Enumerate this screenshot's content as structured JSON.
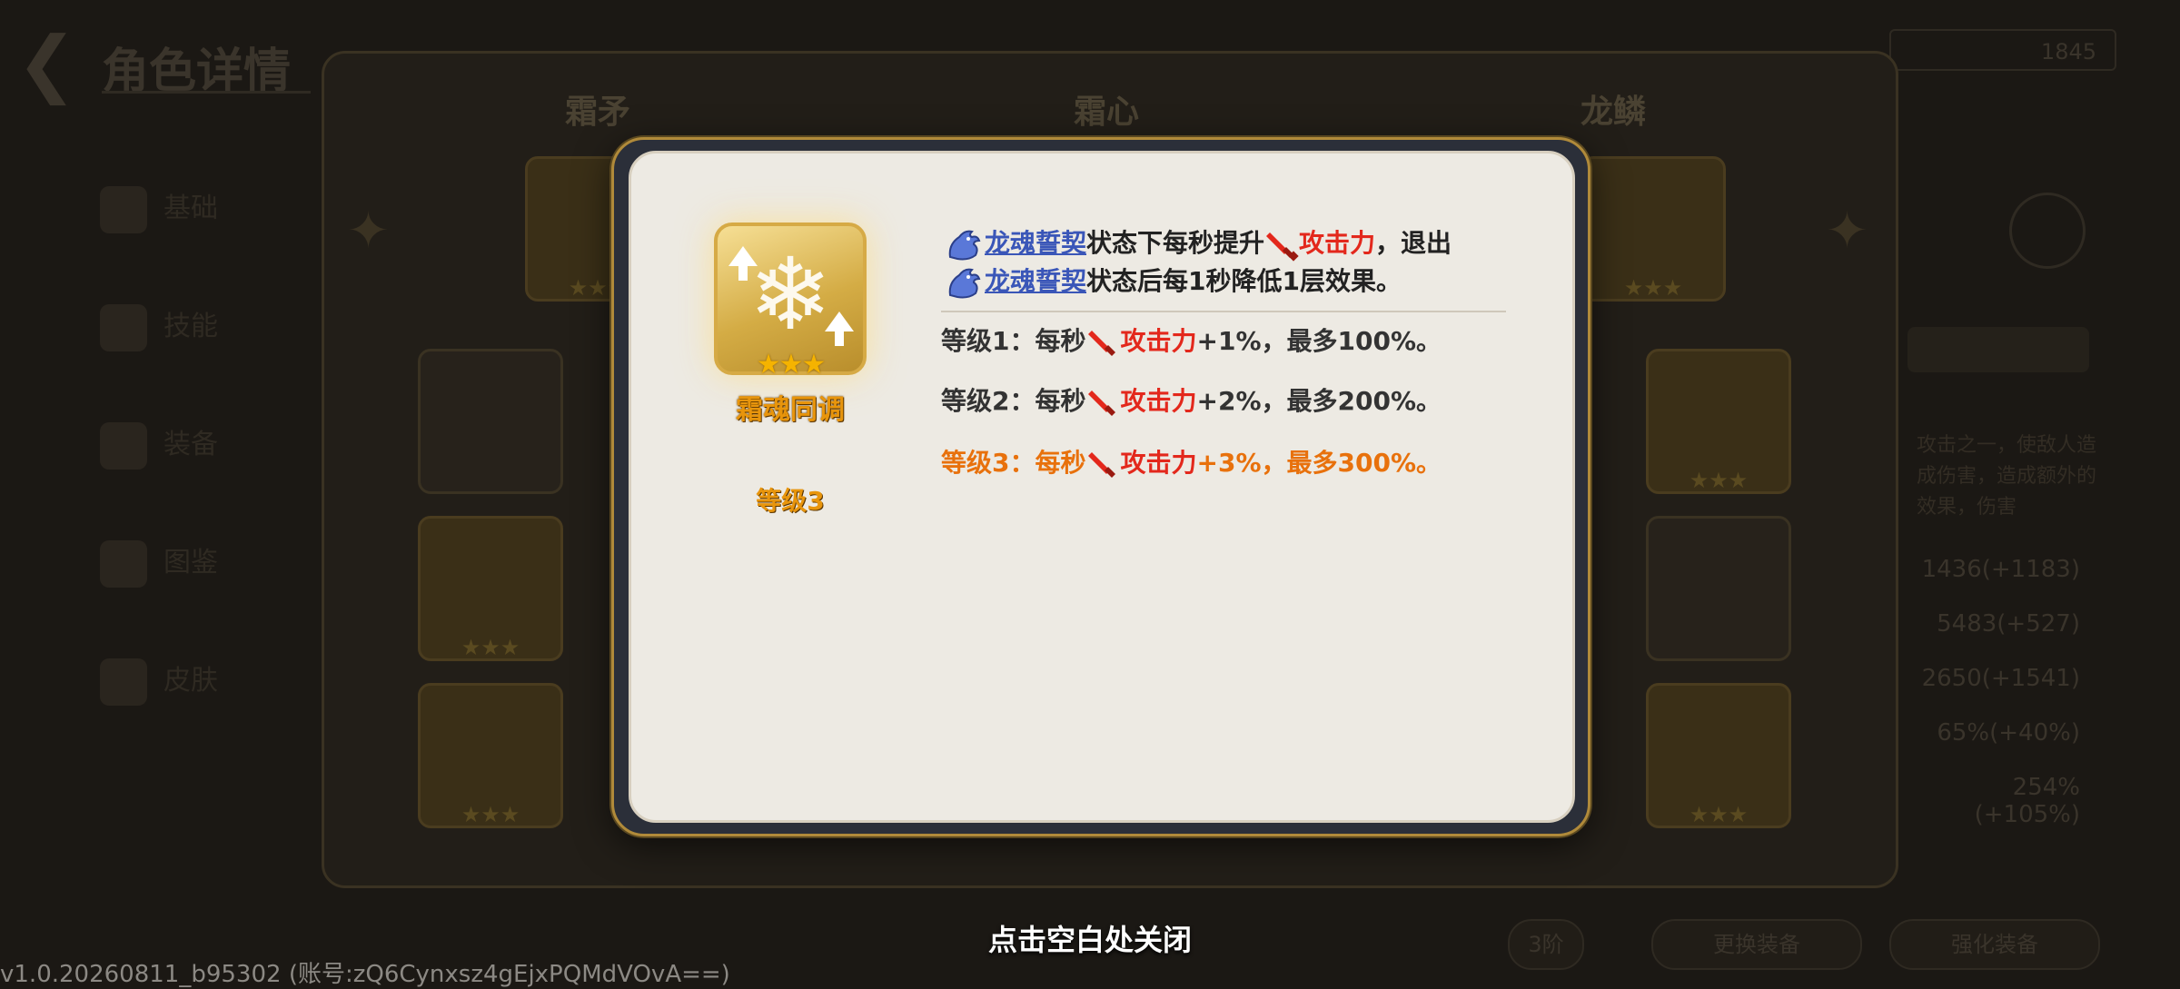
{
  "background": {
    "header_title": "角色详情",
    "top_right_value": "1845",
    "slot_labels": [
      "霜矛",
      "霜心",
      "龙鳞"
    ],
    "sidebar_items": [
      "基础",
      "技能",
      "装备",
      "图鉴",
      "皮肤"
    ],
    "stats": [
      "1436(+1183)",
      "5483(+527)",
      "2650(+1541)",
      "65%(+40%)",
      "254%(+105%)"
    ],
    "desc_text": "攻击之一，使敌人造成伤害，造成额外的效果，伤害",
    "bottom_buttons": [
      "3阶",
      "更换装备",
      "强化装备"
    ]
  },
  "skill": {
    "name": "霜魂同调",
    "stars": "★★★",
    "level": "等级3",
    "icon": "snowflake-upgrade-icon"
  },
  "description": {
    "line1": {
      "keyword": "龙魂誓契",
      "text_before_sword": "状态下每秒提升",
      "stat": "攻击力",
      "text_after": "，退出"
    },
    "line2": {
      "keyword": "龙魂誓契",
      "text": "状态后每1秒降低1层效果。"
    }
  },
  "levels": [
    {
      "label": "等级1：",
      "prefix": "每秒",
      "stat": "攻击力",
      "suffix": "+1%，最多100%。",
      "active": false
    },
    {
      "label": "等级2：",
      "prefix": "每秒",
      "stat": "攻击力",
      "suffix": "+2%，最多200%。",
      "active": false
    },
    {
      "label": "等级3：",
      "prefix": "每秒",
      "stat": "攻击力",
      "suffix": "+3%，最多300%。",
      "active": true
    }
  ],
  "close_hint": "点击空白处关闭",
  "version": "v1.0.20260811_b95302 (账号:zQ6Cynxsz4gEjxPQMdVOvA==)",
  "colors": {
    "accent_orange": "#e8950c",
    "keyword_blue": "#3a56b8",
    "keyword_red": "#e3281c",
    "modal_bg": "#edeae3"
  }
}
